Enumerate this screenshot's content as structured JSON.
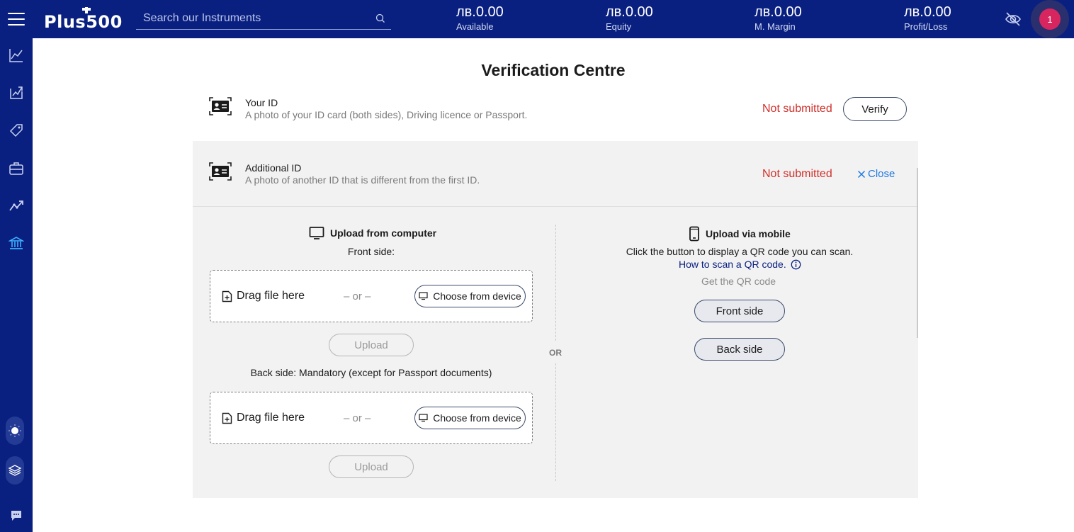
{
  "header": {
    "logo": "Plus500",
    "search_placeholder": "Search our Instruments",
    "stats": [
      {
        "value": "лв.0.00",
        "label": "Available"
      },
      {
        "value": "лв.0.00",
        "label": "Equity"
      },
      {
        "value": "лв.0.00",
        "label": "M. Margin"
      },
      {
        "value": "лв.0.00",
        "label": "Profit/Loss"
      }
    ],
    "notifications_count": "1"
  },
  "sidebar": {
    "items": [
      "chart-line-icon",
      "trades-icon",
      "tag-icon",
      "briefcase-icon",
      "insights-icon",
      "bank-icon"
    ],
    "bottom": [
      "theme-toggle-icon",
      "layers-icon",
      "chat-icon"
    ]
  },
  "page": {
    "title": "Verification Centre",
    "your_id": {
      "title": "Your ID",
      "description": "A photo of your ID card (both sides), Driving licence or Passport.",
      "status": "Not submitted",
      "action": "Verify"
    },
    "additional_id": {
      "title": "Additional ID",
      "description": "A photo of another ID that is different from the first ID.",
      "status": "Not submitted",
      "close_label": "Close"
    },
    "upload_computer": {
      "heading": "Upload from computer",
      "front_label": "Front side:",
      "back_label": "Back side: Mandatory (except for Passport documents)",
      "drag_text": "Drag file here",
      "or_text": "– or –",
      "choose_label": "Choose from device",
      "upload_label": "Upload"
    },
    "or_label": "OR",
    "upload_mobile": {
      "heading": "Upload via mobile",
      "instructions": "Click the button to display a QR code you can scan.",
      "help_link": "How to scan a QR code.",
      "get_qr": "Get the QR code",
      "front_button": "Front side",
      "back_button": "Back side"
    }
  },
  "colors": {
    "brand": "#0a2081",
    "status_red": "#d0302b",
    "link_blue": "#1f7ae0",
    "avatar": "#d7265f"
  }
}
